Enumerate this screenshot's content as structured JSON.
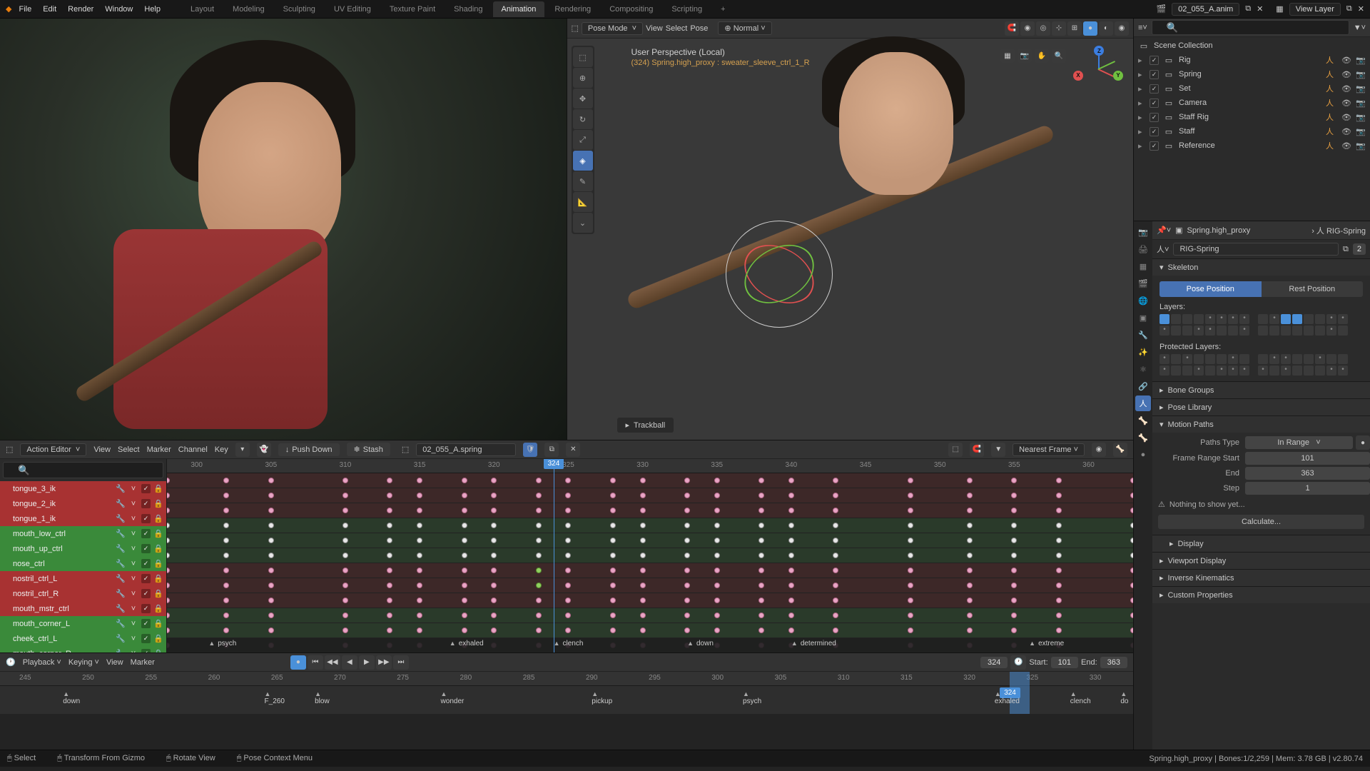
{
  "topmenu": [
    "File",
    "Edit",
    "Render",
    "Window",
    "Help"
  ],
  "workspaces": [
    "Layout",
    "Modeling",
    "Sculpting",
    "UV Editing",
    "Texture Paint",
    "Shading",
    "Animation",
    "Rendering",
    "Compositing",
    "Scripting"
  ],
  "active_workspace": "Animation",
  "scene_name": "02_055_A.anim",
  "view_layer_label": "View Layer",
  "viewport": {
    "mode": "Pose Mode",
    "menu": [
      "View",
      "Select",
      "Pose"
    ],
    "orient": "Normal",
    "perspective": "User Perspective (Local)",
    "selection": "(324) Spring.high_proxy : sweater_sleeve_ctrl_1_R",
    "nav_label": "Trackball"
  },
  "action_editor": {
    "type": "Action Editor",
    "menu": [
      "View",
      "Select",
      "Marker",
      "Channel",
      "Key"
    ],
    "push_down": "Push Down",
    "stash": "Stash",
    "action_name": "02_055_A.spring",
    "nearest": "Nearest Frame",
    "channels": [
      {
        "name": "tongue_3_ik",
        "color": "r"
      },
      {
        "name": "tongue_2_ik",
        "color": "r"
      },
      {
        "name": "tongue_1_ik",
        "color": "r"
      },
      {
        "name": "mouth_low_ctrl",
        "color": "g"
      },
      {
        "name": "mouth_up_ctrl",
        "color": "g"
      },
      {
        "name": "nose_ctrl",
        "color": "g"
      },
      {
        "name": "nostril_ctrl_L",
        "color": "r"
      },
      {
        "name": "nostril_ctrl_R",
        "color": "r"
      },
      {
        "name": "mouth_mstr_ctrl",
        "color": "r"
      },
      {
        "name": "mouth_corner_L",
        "color": "g"
      },
      {
        "name": "cheek_ctrl_L",
        "color": "g"
      },
      {
        "name": "mouth_corner_R",
        "color": "g"
      }
    ],
    "frame_start": 300,
    "frame_ticks": [
      300,
      305,
      310,
      315,
      320,
      325,
      330,
      335,
      340,
      345,
      350,
      355,
      360
    ],
    "current_frame": 324,
    "markers": [
      {
        "frame": 300.8,
        "name": "psych"
      },
      {
        "frame": 317,
        "name": "exhaled"
      },
      {
        "frame": 324,
        "name": "clench"
      },
      {
        "frame": 333,
        "name": "down"
      },
      {
        "frame": 340,
        "name": "determined"
      },
      {
        "frame": 356,
        "name": "extreme"
      }
    ]
  },
  "timeline": {
    "menu": [
      "Playback",
      "Keying",
      "View",
      "Marker"
    ],
    "current_frame": 324,
    "start_label": "Start:",
    "start": 101,
    "end_label": "End:",
    "end": 363,
    "ticks": [
      245,
      250,
      255,
      260,
      265,
      270,
      275,
      280,
      285,
      290,
      295,
      300,
      305,
      310,
      315,
      320,
      324,
      325,
      330
    ],
    "markers": [
      {
        "frame": 248,
        "name": "down"
      },
      {
        "frame": 258,
        "name": "F_260"
      },
      {
        "frame": 268,
        "name": "blow"
      },
      {
        "frame": 308,
        "name": "wonder"
      },
      {
        "frame": 345,
        "name": "pickup"
      },
      {
        "frame": 387,
        "name": "psych"
      },
      {
        "frame": 530,
        "name": "exhaled"
      },
      {
        "frame": 565,
        "name": "clench"
      },
      {
        "frame": 625,
        "name": "do"
      }
    ],
    "playhead_pct": 83
  },
  "outliner": {
    "root": "Scene Collection",
    "items": [
      {
        "name": "Rig"
      },
      {
        "name": "Spring"
      },
      {
        "name": "Set"
      },
      {
        "name": "Camera"
      },
      {
        "name": "Staff Rig"
      },
      {
        "name": "Staff"
      },
      {
        "name": "Reference"
      }
    ]
  },
  "properties": {
    "object": "Spring.high_proxy",
    "armature": "RIG-Spring",
    "armature2": "RIG-Spring",
    "users": 2,
    "skeleton_label": "Skeleton",
    "pose_pos": "Pose Position",
    "rest_pos": "Rest Position",
    "layers_label": "Layers:",
    "protected_label": "Protected Layers:",
    "panels": [
      "Bone Groups",
      "Pose Library",
      "Motion Paths"
    ],
    "paths_type_label": "Paths Type",
    "paths_type": "In Range",
    "range_start_label": "Frame Range Start",
    "range_start": 101,
    "range_end_label": "End",
    "range_end": 363,
    "step_label": "Step",
    "step": 1,
    "warn": "Nothing to show yet...",
    "calculate": "Calculate...",
    "panels2": [
      "Display",
      "Viewport Display",
      "Inverse Kinematics",
      "Custom Properties"
    ]
  },
  "status": {
    "select": "Select",
    "transform": "Transform From Gizmo",
    "rotate": "Rotate View",
    "context": "Pose Context Menu",
    "info": "Spring.high_proxy | Bones:1/2,259 | Mem: 3.78 GB | v2.80.74"
  }
}
